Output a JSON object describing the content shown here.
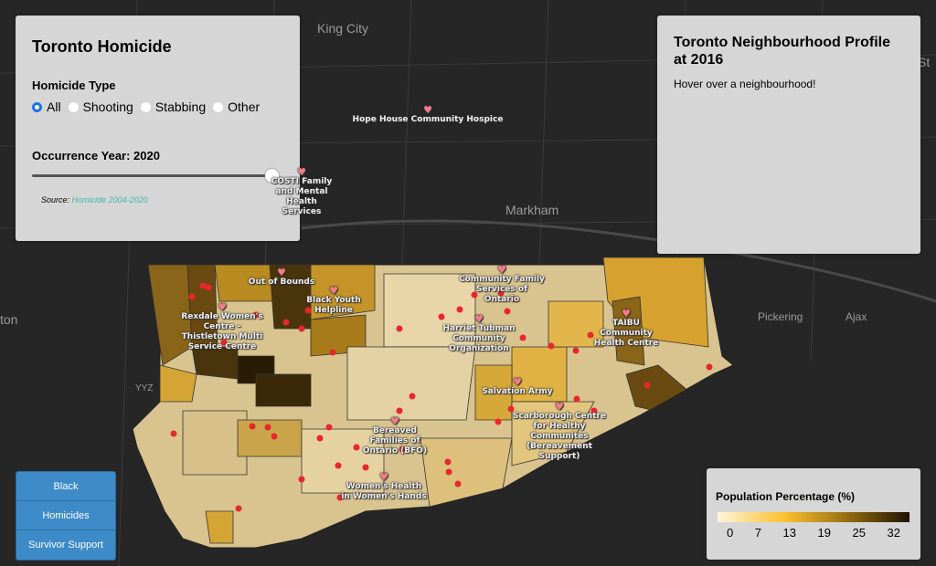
{
  "control_panel": {
    "title": "Toronto Homicide",
    "type_label": "Homicide Type",
    "types": [
      {
        "label": "All",
        "selected": true
      },
      {
        "label": "Shooting",
        "selected": false
      },
      {
        "label": "Stabbing",
        "selected": false
      },
      {
        "label": "Other",
        "selected": false
      }
    ],
    "year_label": "Occurrence Year: 2020",
    "year_value": 2020,
    "year_range": [
      2004,
      2020
    ],
    "source_prefix": "Source:",
    "source_link": "Homicide 2004-2020"
  },
  "profile_panel": {
    "title": "Toronto Neighbourhood Profile at 2016",
    "hint": "Hover over a neighbourhood!"
  },
  "layers": [
    "Black",
    "Homicides",
    "Survivor Support"
  ],
  "legend": {
    "title": "Population Percentage (%)",
    "ticks": [
      "0",
      "7",
      "13",
      "19",
      "25",
      "32"
    ],
    "colors": [
      "#fff5dc",
      "#fbc02d",
      "#a07414",
      "#1e1200"
    ]
  },
  "map_labels": [
    "King City",
    "Markham",
    "Pickering",
    "Ajax",
    "YYZ",
    "ton",
    "St"
  ],
  "services": [
    "Hope House Community Hospice",
    "COSTI Family and Mental Health Services",
    "Out of Bounds",
    "Black Youth Helpline",
    "Rexdale Women's Centre - Thistletown Multi Service Centre",
    "Community Family Services of Ontario",
    "Harriet Tubman Community Organization",
    "TAIBU Community Health Centre",
    "Salvation Army",
    "Scarborough Centre for Healthy Communites (Bereavement Support)",
    "Bereaved Families of Ontario (BFO)",
    "Women's Health in Women's Hands"
  ],
  "colors": {
    "homicide_marker": "#e8262e",
    "service_heart": "#f47a86",
    "layer_button": "#3d8bc9"
  }
}
